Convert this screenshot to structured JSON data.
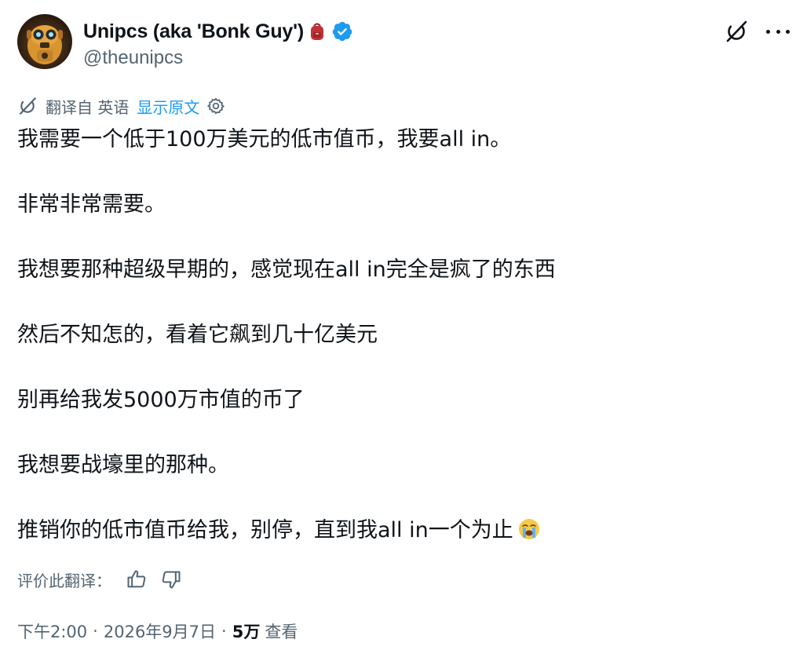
{
  "author": {
    "display_name": "Unipcs (aka 'Bonk Guy')",
    "handle": "@theunipcs",
    "name_emoji": "backpack",
    "verified": true
  },
  "header_actions": {
    "grok_icon": "grok-icon",
    "more_icon": "more-horizontal-icon"
  },
  "translation": {
    "translated_from": "翻译自 英语",
    "show_original": "显示原文",
    "settings_icon": "gear-icon"
  },
  "tweet": {
    "paragraphs": [
      "我需要一个低于100万美元的低市值币，我要all in。",
      "非常非常需要。",
      "我想要那种超级早期的，感觉现在all in完全是疯了的东西",
      "然后不知怎的，看着它飙到几十亿美元",
      "别再给我发5000万市值的币了",
      "我想要战壕里的那种。",
      "推销你的低市值币给我，别停，直到我all in一个为止"
    ],
    "trailing_emoji": "loudly-crying-face"
  },
  "rate_translation": {
    "label": "评价此翻译："
  },
  "meta": {
    "time": "下午2:00",
    "separator": "·",
    "date": "2026年9月7日",
    "views_count": "5万",
    "views_label": "查看"
  },
  "colors": {
    "text": "#0f1419",
    "secondary": "#536471",
    "accent": "#1d9bf0"
  }
}
